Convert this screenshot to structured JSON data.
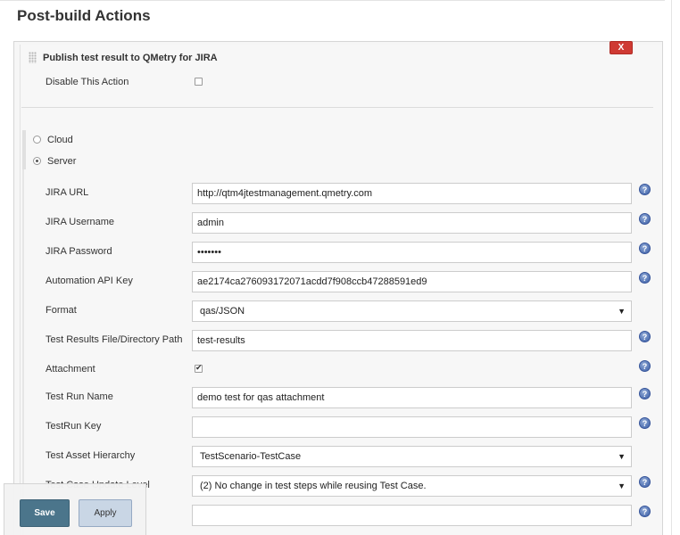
{
  "section": {
    "title": "Post-build Actions"
  },
  "plugin": {
    "title": "Publish test result to QMetry for JIRA",
    "delete_label": "X",
    "disable_label": "Disable This Action"
  },
  "deployment": {
    "options": [
      {
        "label": "Cloud",
        "selected": false
      },
      {
        "label": "Server",
        "selected": true
      }
    ]
  },
  "fields": {
    "jira_url": {
      "label": "JIRA URL",
      "value": "http://qtm4jtestmanagement.qmetry.com"
    },
    "jira_username": {
      "label": "JIRA Username",
      "value": "admin"
    },
    "jira_password": {
      "label": "JIRA Password",
      "value": "•••••••"
    },
    "api_key": {
      "label": "Automation API Key",
      "value": "ae2174ca276093172071acdd7f908ccb47288591ed9"
    },
    "format": {
      "label": "Format",
      "value": "qas/JSON"
    },
    "results_path": {
      "label": "Test Results File/Directory Path",
      "value": "test-results"
    },
    "attachment": {
      "label": "Attachment",
      "checked": true
    },
    "test_run_name": {
      "label": "Test Run Name",
      "value": "demo test for qas attachment"
    },
    "test_run_key": {
      "label": "TestRun Key",
      "value": ""
    },
    "asset_hierarchy": {
      "label": "Test Asset Hierarchy",
      "value": "TestScenario-TestCase"
    },
    "update_level": {
      "label": "Test Case Update Level",
      "value": "(2) No change in test steps while reusing Test Case."
    },
    "next_field": {
      "label": "",
      "value": ""
    }
  },
  "help_glyph": "?",
  "dropdown_glyph": "▼",
  "buttons": {
    "save": "Save",
    "apply": "Apply"
  }
}
